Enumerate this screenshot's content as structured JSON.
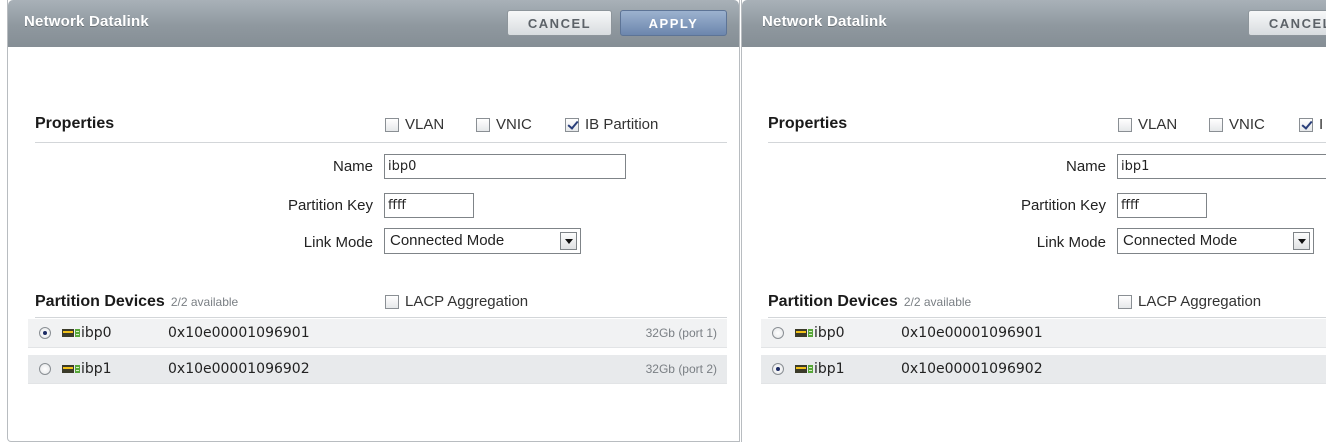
{
  "dialogs": [
    {
      "title": "Network Datalink",
      "cancel_label": "CANCEL",
      "apply_label": "APPLY",
      "properties_title": "Properties",
      "checkboxes": [
        {
          "label": "VLAN",
          "checked": false
        },
        {
          "label": "VNIC",
          "checked": false
        },
        {
          "label": "IB Partition",
          "checked": true
        }
      ],
      "name_label": "Name",
      "name_value": "ibp0",
      "pkey_label": "Partition Key",
      "pkey_value": "ffff",
      "link_mode_label": "Link Mode",
      "link_mode_value": "Connected Mode",
      "devices_title": "Partition Devices",
      "devices_available": "2/2 available",
      "lacp_label": "LACP Aggregation",
      "devices": [
        {
          "name": "ibp0",
          "guid": "0x10e00001096901",
          "speed": "32Gb (port 1)",
          "selected": true
        },
        {
          "name": "ibp1",
          "guid": "0x10e00001096902",
          "speed": "32Gb (port 2)",
          "selected": false
        }
      ]
    },
    {
      "title": "Network Datalink",
      "cancel_label": "CANCEL",
      "properties_title": "Properties",
      "checkboxes": [
        {
          "label": "VLAN",
          "checked": false
        },
        {
          "label": "VNIC",
          "checked": false
        },
        {
          "label": "I",
          "checked": true
        }
      ],
      "name_label": "Name",
      "name_value": "ibp1",
      "pkey_label": "Partition Key",
      "pkey_value": "ffff",
      "link_mode_label": "Link Mode",
      "link_mode_value": "Connected Mode",
      "devices_title": "Partition Devices",
      "devices_available": "2/2 available",
      "lacp_label": "LACP Aggregation",
      "devices": [
        {
          "name": "ibp0",
          "guid": "0x10e00001096901",
          "selected": false
        },
        {
          "name": "ibp1",
          "guid": "0x10e00001096902",
          "selected": true
        }
      ]
    }
  ],
  "colors": {
    "titlebar": "#8f989f",
    "apply_button": "#6c86ad",
    "row_odd": "#f1f2f3",
    "row_even": "#e8eaec"
  },
  "icons": {
    "device": "network-device-icon"
  }
}
